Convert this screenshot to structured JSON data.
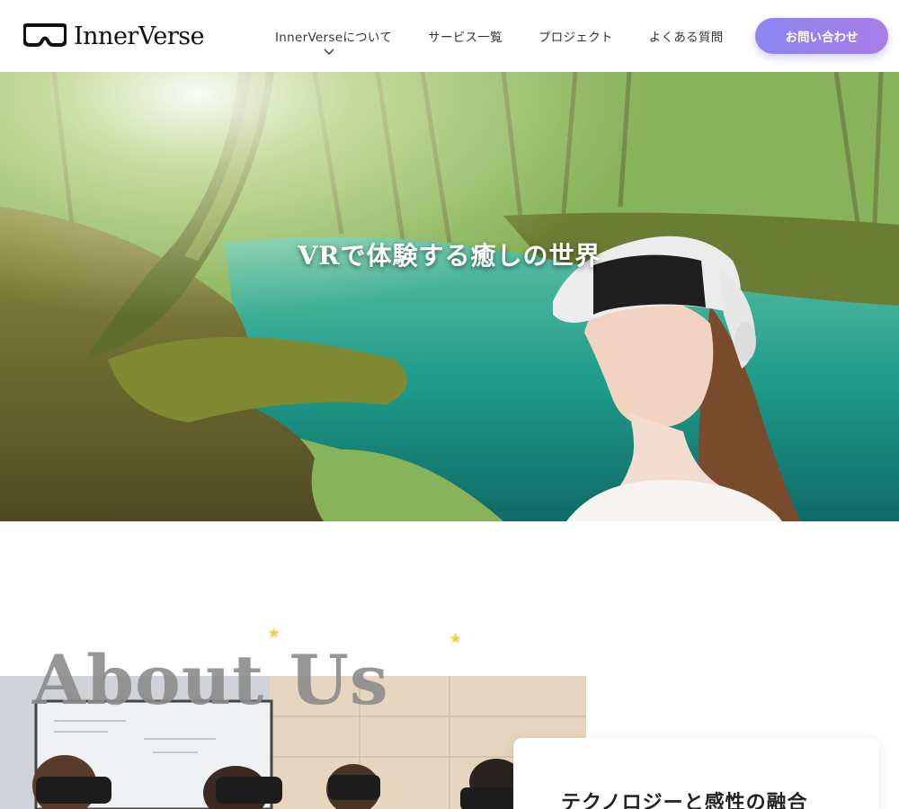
{
  "header": {
    "logo_text": "InnerVerse",
    "logo_icon": "vr-goggles-icon",
    "nav": [
      {
        "label": "InnerVerseについて",
        "has_dropdown": true
      },
      {
        "label": "サービス一覧"
      },
      {
        "label": "プロジェクト"
      },
      {
        "label": "よくある質問"
      }
    ],
    "cta_label": "お問い合わせ",
    "cta_colors": [
      "#8a86f2",
      "#a77de8"
    ]
  },
  "hero": {
    "title": "VRで体験する癒しの世界"
  },
  "about": {
    "heading": "About Us",
    "card_title": "テクノロジーと感性の融合",
    "star_color": "#f2d04a"
  }
}
